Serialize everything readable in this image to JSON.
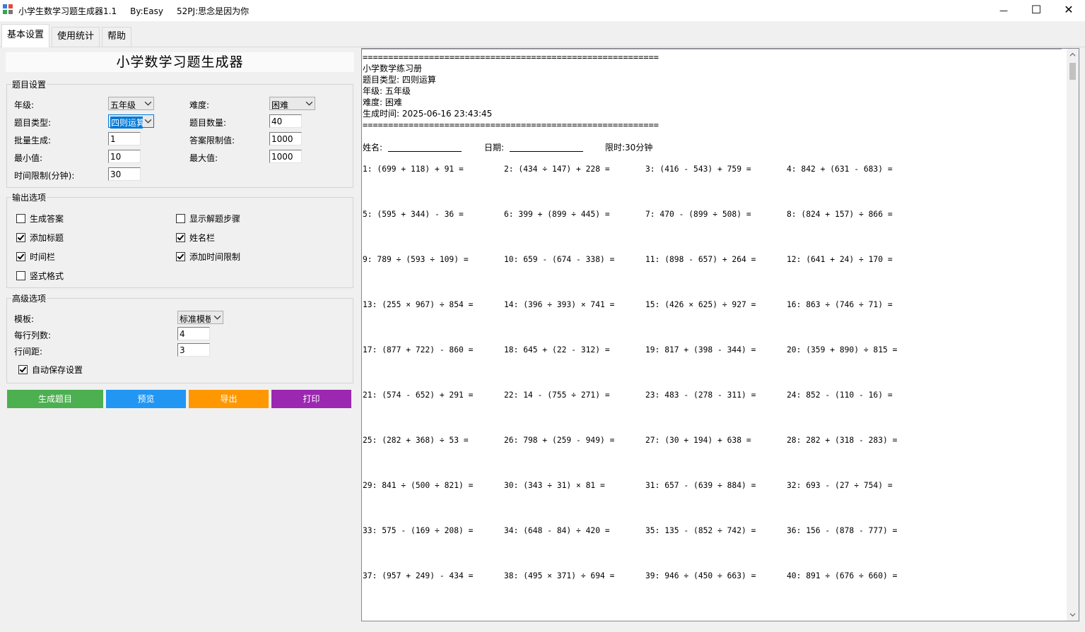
{
  "window": {
    "title": "小学生数学习题生成器1.1     By:Easy     52PJ:思念是因为你",
    "minimize_glyph": "—",
    "maximize_glyph": "☐",
    "close_glyph": "✕",
    "icon": "app-grid-icon"
  },
  "tabs": [
    {
      "label": "基本设置",
      "active": true
    },
    {
      "label": "使用统计",
      "active": false
    },
    {
      "label": "帮助",
      "active": false
    }
  ],
  "app_heading": "小学数学习题生成器",
  "question_settings": {
    "group_label": "题目设置",
    "grade_label": "年级:",
    "grade_value": "五年级",
    "difficulty_label": "难度:",
    "difficulty_value": "困难",
    "type_label": "题目类型:",
    "type_value": "四则运算",
    "count_label": "题目数量:",
    "count_value": "40",
    "batch_label": "批量生成:",
    "batch_value": "1",
    "answer_limit_label": "答案限制值:",
    "answer_limit_value": "1000",
    "min_label": "最小值:",
    "min_value": "10",
    "max_label": "最大值:",
    "max_value": "1000",
    "time_limit_label": "时间限制(分钟):",
    "time_limit_value": "30"
  },
  "output_options": {
    "group_label": "输出选项",
    "generate_answers": {
      "label": "生成答案",
      "checked": false
    },
    "show_steps": {
      "label": "显示解题步骤",
      "checked": false
    },
    "add_title": {
      "label": "添加标题",
      "checked": true
    },
    "name_field": {
      "label": "姓名栏",
      "checked": true
    },
    "time_field": {
      "label": "时间栏",
      "checked": true
    },
    "add_time_limit": {
      "label": "添加时间限制",
      "checked": true
    },
    "vertical_format": {
      "label": "竖式格式",
      "checked": false
    }
  },
  "advanced_options": {
    "group_label": "高级选项",
    "template_label": "模板:",
    "template_value": "标准模板",
    "columns_label": "每行列数:",
    "columns_value": "4",
    "line_spacing_label": "行间距:",
    "line_spacing_value": "3",
    "auto_save": {
      "label": "自动保存设置",
      "checked": true
    }
  },
  "buttons": {
    "generate": {
      "label": "生成题目",
      "color": "#4caf50"
    },
    "preview": {
      "label": "预览",
      "color": "#2196f3"
    },
    "export": {
      "label": "导出",
      "color": "#ff9800"
    },
    "print": {
      "label": "打印",
      "color": "#9c27b0"
    }
  },
  "preview": {
    "separator": "==========================================================",
    "heading": "小学数学练习册",
    "type_line": "题目类型: 四则运算",
    "grade_line": "年级: 五年级",
    "difficulty_line": "难度: 困难",
    "generated_line": "生成时间: 2025-06-16 23:43:45",
    "name_label": "姓名:",
    "date_label": "日期:",
    "time_limit_text": "限时:30分钟",
    "problems": [
      "1: (699 + 118) + 91 =",
      "2: (434 ÷ 147) + 228 =",
      "3: (416 - 543) + 759 =",
      "4: 842 + (631 - 683) =",
      "5: (595 + 344) - 36 =",
      "6: 399 + (899 ÷ 445) =",
      "7: 470 - (899 ÷ 508) =",
      "8: (824 + 157) ÷ 866 =",
      "9: 789 ÷ (593 ÷ 109) =",
      "10: 659 - (674 - 338) =",
      "11: (898 - 657) + 264 =",
      "12: (641 + 24) ÷ 170 =",
      "13: (255 × 967) ÷ 854 =",
      "14: (396 ÷ 393) × 741 =",
      "15: (426 × 625) ÷ 927 =",
      "16: 863 ÷ (746 ÷ 71) =",
      "17: (877 + 722) - 860 =",
      "18: 645 + (22 - 312) =",
      "19: 817 + (398 - 344) =",
      "20: (359 + 890) ÷ 815 =",
      "21: (574 - 652) + 291 =",
      "22: 14 - (755 ÷ 271) =",
      "23: 483 - (278 - 311) =",
      "24: 852 - (110 - 16) =",
      "25: (282 + 368) ÷ 53 =",
      "26: 798 + (259 - 949) =",
      "27: (30 + 194) + 638 =",
      "28: 282 + (318 - 283) =",
      "29: 841 ÷ (500 ÷ 821) =",
      "30: (343 ÷ 31) × 81 =",
      "31: 657 - (639 ÷ 884) =",
      "32: 693 - (27 ÷ 754) =",
      "33: 575 - (169 ÷ 208) =",
      "34: (648 - 84) ÷ 420 =",
      "35: 135 - (852 ÷ 742) =",
      "36: 156 - (878 - 777) =",
      "37: (957 + 249) - 434 =",
      "38: (495 × 371) ÷ 694 =",
      "39: 946 ÷ (450 ÷ 663) =",
      "40: 891 ÷ (676 ÷ 660) ="
    ]
  }
}
